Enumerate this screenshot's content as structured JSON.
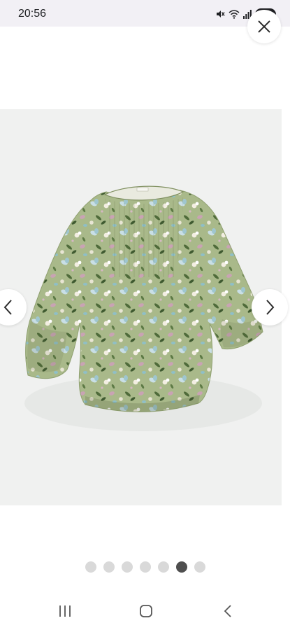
{
  "status_bar": {
    "time": "20:56",
    "battery_level": "70",
    "icons": [
      "mute-icon",
      "wifi-icon",
      "signal-icon",
      "battery-icon"
    ]
  },
  "carousel": {
    "total_images": 7,
    "active_index": 5
  },
  "colors": {
    "status_bar_bg": "#f2f0f5",
    "image_bg": "#f0f1f0",
    "garment_green": "#a9b98a",
    "active_dot": "#4f4f4f",
    "inactive_dot": "#d9d9d9"
  },
  "system_nav": {
    "icons": [
      "recent-apps-icon",
      "home-icon",
      "back-icon"
    ]
  }
}
